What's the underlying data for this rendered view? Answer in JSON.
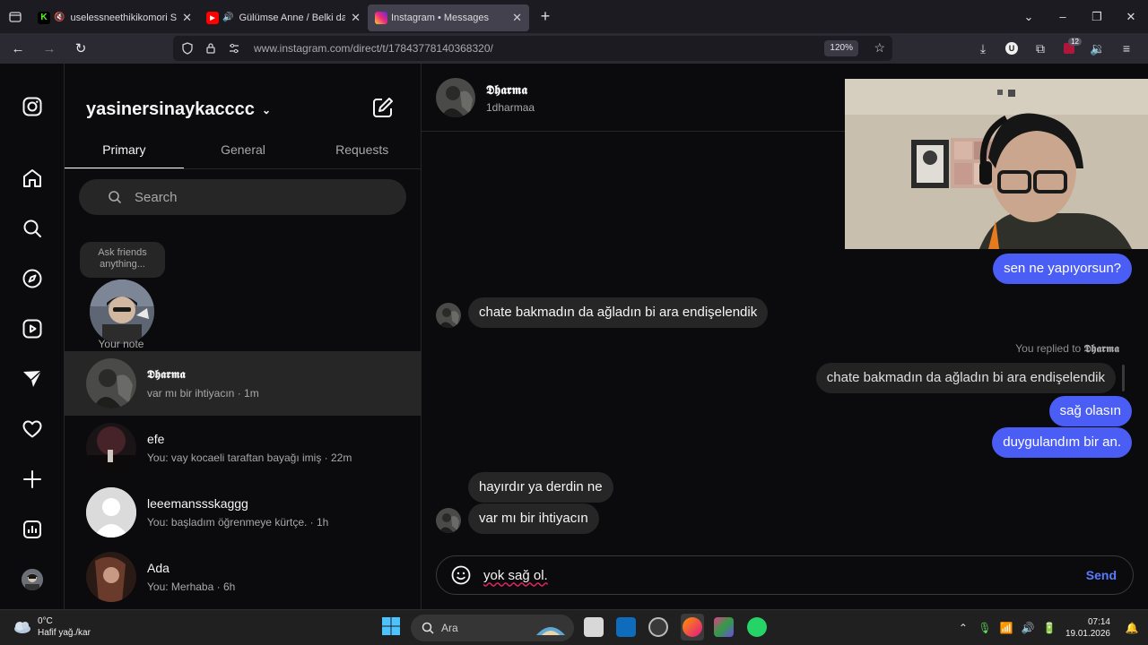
{
  "browser": {
    "tabs": [
      {
        "title": "uselessneethikikomori Strea",
        "favicon": "kick-icon",
        "color": "#53fc18"
      },
      {
        "title": "Gülümse Anne / Belki dağla",
        "favicon": "youtube-icon",
        "color": "#ff0000"
      },
      {
        "title": "Instagram • Messages",
        "favicon": "instagram-icon",
        "color": "#e1306c"
      }
    ],
    "url": "www.instagram.com/direct/t/17843778140368320/",
    "zoom": "120%",
    "extension_badge": "12"
  },
  "inbox": {
    "username": "yasinersinaykacccc",
    "tabs": [
      "Primary",
      "General",
      "Requests"
    ],
    "search_placeholder": "Search",
    "note_bubble": "Ask friends anything...",
    "note_label": "Your note",
    "threads": [
      {
        "name": "𝕯𝖍𝖆𝖗𝖒𝖆",
        "preview": "var mı bir ihtiyacın · 1m"
      },
      {
        "name": "efe",
        "preview": "You: vay kocaeli taraftan bayağı imiş · 22m"
      },
      {
        "name": "leeemanssskaggg",
        "preview": "You: başladım öğrenmeye kürtçe. · 1h"
      },
      {
        "name": "Ada",
        "preview": "You: Merhaba · 6h"
      }
    ]
  },
  "chat": {
    "name": "𝕯𝖍𝖆𝖗𝖒𝖆",
    "handle": "1dharmaa",
    "messages": {
      "m1": "sen ne yapıyorsun?",
      "m2": "chate bakmadın da ağladın bi ara endişelendik",
      "reply_prefix": "You replied to",
      "reply_name": "𝕯𝖍𝖆𝖗𝖒𝖆",
      "m3": "chate bakmadın da ağladın bi ara endişelendik",
      "m4": "sağ olasın",
      "m5": "duygulandım bir an.",
      "m6": "hayırdır ya derdin ne",
      "m7": "var mı bir ihtiyacın"
    },
    "composer_text": "yok sağ ol.",
    "send_label": "Send"
  },
  "taskbar": {
    "weather_temp": "0°C",
    "weather_desc": "Hafif yağ./kar",
    "search_label": "Ara",
    "time": "07:14",
    "date": "19.01.2026"
  }
}
